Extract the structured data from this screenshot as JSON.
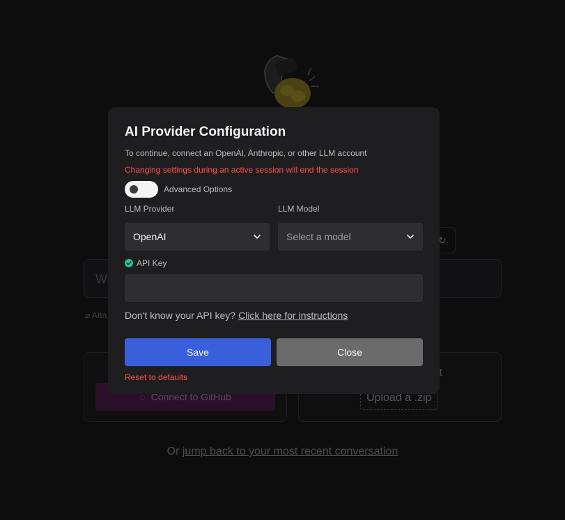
{
  "background": {
    "logo_icon": "chef-hat-hands-icon",
    "refresh_icon": "refresh-icon",
    "input_placeholder": "Wh",
    "attach_label": "Atta",
    "github_card": {
      "button_label": "Connect to GitHub",
      "icon": "github-icon"
    },
    "upload_card": {
      "title_fragment": "t",
      "button_label": "Upload a .zip"
    },
    "recent": {
      "prefix": "Or ",
      "link": "jump back to your most recent conversation"
    }
  },
  "modal": {
    "title": "AI Provider Configuration",
    "subtitle": "To continue, connect an OpenAI, Anthropic, or other LLM account",
    "warning": "Changing settings during an active session will end the session",
    "advanced_options": {
      "label": "Advanced Options",
      "enabled": false
    },
    "provider": {
      "label": "LLM Provider",
      "value": "OpenAI"
    },
    "model": {
      "label": "LLM Model",
      "placeholder": "Select a model"
    },
    "api_key": {
      "label": "API Key",
      "value": "",
      "status_icon": "check-circle-icon"
    },
    "help": {
      "text": "Don't know your API key?",
      "link": "Click here for instructions"
    },
    "buttons": {
      "save": "Save",
      "close": "Close"
    },
    "reset": "Reset to defaults"
  },
  "colors": {
    "accent": "#3a5fdb",
    "danger": "#ff4d4d",
    "success": "#22c59b",
    "modal_bg": "#1e1e20"
  }
}
